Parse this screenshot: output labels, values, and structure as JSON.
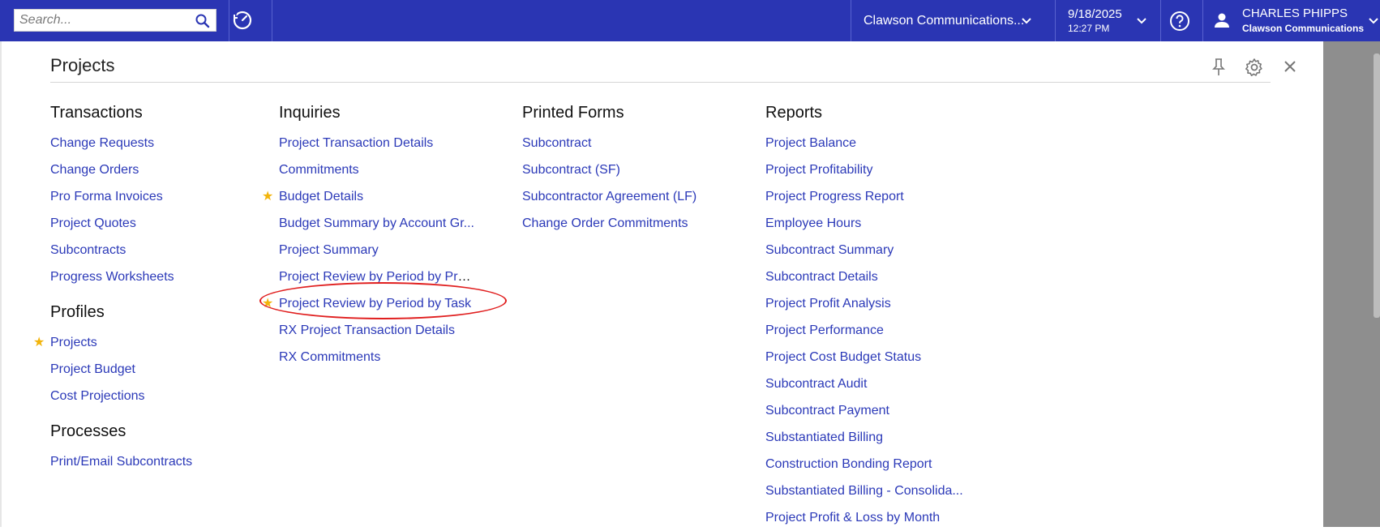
{
  "topbar": {
    "search_placeholder": "Search...",
    "company": "Clawson Communications...",
    "date": "9/18/2025",
    "time": "12:27 PM",
    "user_name": "CHARLES PHIPPS",
    "user_company": "Clawson Communications",
    "colors": {
      "bar": "#2a35b3",
      "link": "#2b39b8",
      "star": "#f2b40b",
      "annotation": "#e01e1e"
    }
  },
  "panel": {
    "title": "Projects"
  },
  "transactions": {
    "heading": "Transactions",
    "items": [
      "Change Requests",
      "Change Orders",
      "Pro Forma Invoices",
      "Project Quotes",
      "Subcontracts",
      "Progress Worksheets"
    ]
  },
  "profiles": {
    "heading": "Profiles",
    "items": [
      "Projects",
      "Project Budget",
      "Cost Projections"
    ],
    "starred": [
      "Projects"
    ]
  },
  "processes": {
    "heading": "Processes",
    "items": [
      "Print/Email Subcontracts"
    ]
  },
  "inquiries": {
    "heading": "Inquiries",
    "items": [
      "Project Transaction Details",
      "Commitments",
      "Budget Details",
      "Budget Summary by Account Gr...",
      "Project Summary",
      "Project Review by Period by Proj...",
      "Project Review by Period by Task",
      "RX Project Transaction Details",
      "RX Commitments"
    ],
    "starred": [
      "Budget Details",
      "Project Review by Period by Task"
    ]
  },
  "printed_forms": {
    "heading": "Printed Forms",
    "items": [
      "Subcontract",
      "Subcontract (SF)",
      "Subcontractor Agreement (LF)",
      "Change Order Commitments"
    ]
  },
  "reports": {
    "heading": "Reports",
    "items": [
      "Project Balance",
      "Project Profitability",
      "Project Progress Report",
      "Employee Hours",
      "Subcontract Summary",
      "Subcontract Details",
      "Project Profit Analysis",
      "Project Performance",
      "Project Cost Budget Status",
      "Subcontract Audit",
      "Subcontract Payment",
      "Substantiated Billing",
      "Construction Bonding Report",
      "Substantiated Billing - Consolida...",
      "Project Profit & Loss by Month"
    ]
  }
}
